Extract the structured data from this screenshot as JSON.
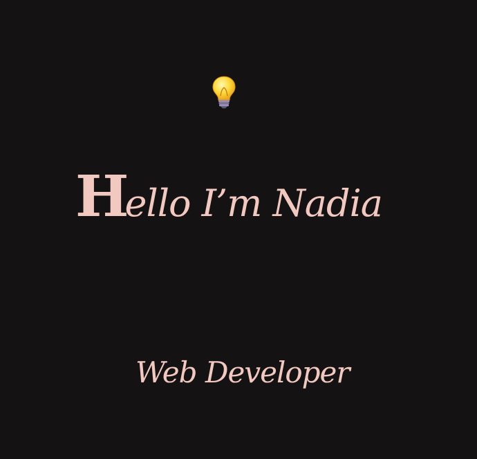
{
  "page": {
    "background": "#141213",
    "text_color": "#f2c9c0"
  },
  "theme_toggle": {
    "icon": "lightbulb-icon"
  },
  "hero": {
    "initial": "H",
    "rest": "ello I’m Nadia",
    "subtitle": "Web Developer"
  }
}
